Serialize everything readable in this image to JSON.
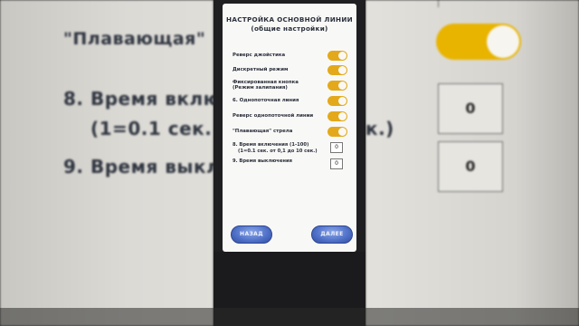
{
  "background": {
    "left": {
      "floating_label": "\"Плавающая\"",
      "item8_line1": "8. Время вклю",
      "item8_line2": "(1=0.1 сек.",
      "item9": "9. Время выкл"
    },
    "right": {
      "item8_suffix": "к.)",
      "value_on_time": "0",
      "value_off_time": "0",
      "toggle_state": "on"
    }
  },
  "screen": {
    "title_line1": "НАСТРОЙКА ОСНОВНОЙ ЛИНИИ",
    "title_line2": "(общие настройки)",
    "toggles": [
      {
        "label": "Реверс джойстика",
        "on": true
      },
      {
        "label": "Дискретный режим",
        "on": true
      },
      {
        "label": "Фиксированная кнопка\n(Режим залипания)",
        "on": true
      },
      {
        "label": "6. Однопоточная линия",
        "on": true
      },
      {
        "label": "Реверс однопоточной линии",
        "on": true
      },
      {
        "label": "\"Плавающая\" стрела",
        "on": true
      }
    ],
    "on_time": {
      "label_line1": "8. Время включения (1-100)",
      "label_line2": "(1=0.1 сек. от 0,1 до 10 сек.)",
      "value": "0"
    },
    "off_time": {
      "label": "9. Время выключения",
      "value": "0"
    },
    "back_button": "НАЗАД",
    "next_button": "ДАЛЕЕ"
  },
  "colors": {
    "toggle_on": "#e3a91a",
    "button": "#4e6fc7",
    "screen_bg": "#f8f8f6",
    "text": "#2a2f3b"
  }
}
